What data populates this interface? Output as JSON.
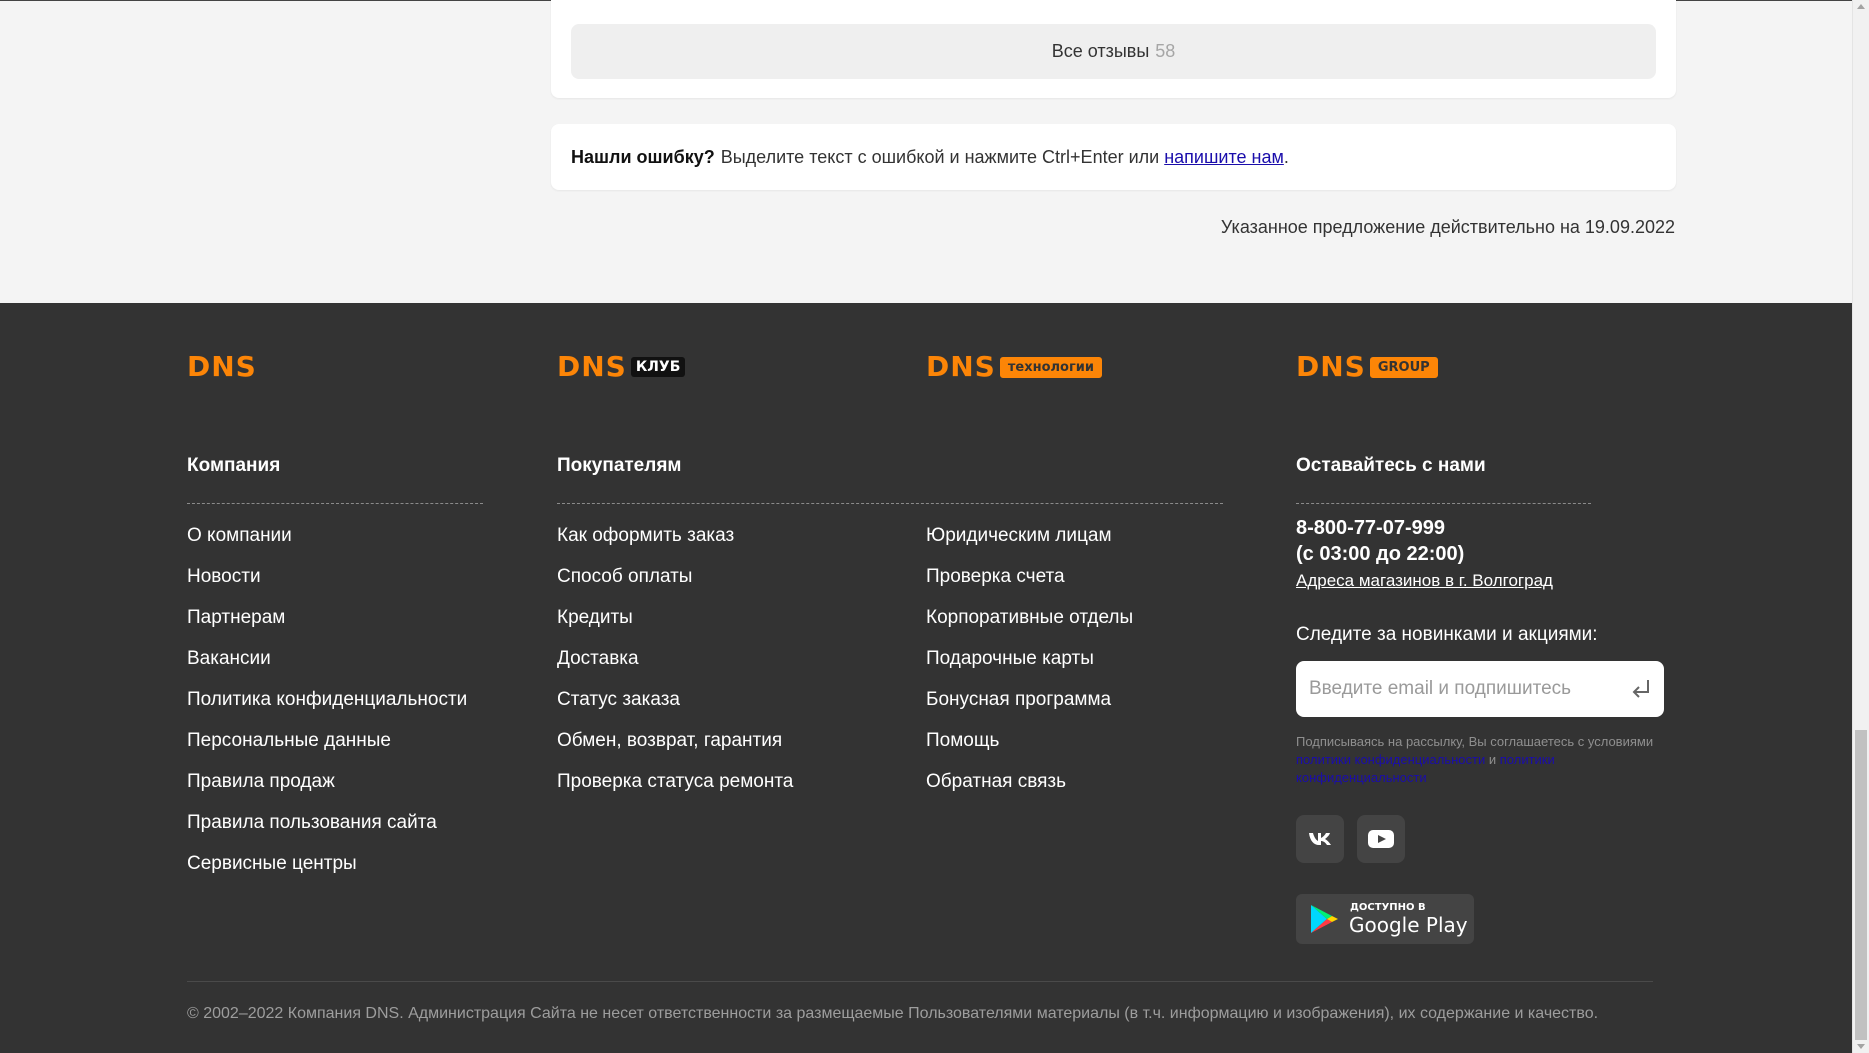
{
  "reviews": {
    "label": "Все отзывы",
    "count": "58"
  },
  "error_notice": {
    "bold": "Нашли ошибку?",
    "text": "Выделите текст с ошибкой и нажмите Ctrl+Enter или",
    "link": "напишите нам",
    "end": "."
  },
  "offer_note": "Указанное предложение действительно на 19.09.2022",
  "logos": {
    "dns": "DNS",
    "club_tag": "КЛУБ",
    "tech_tag": "технологии",
    "group_tag": "GROUP"
  },
  "columns": {
    "company": {
      "title": "Компания",
      "links": [
        "О компании",
        "Новости",
        "Партнерам",
        "Вакансии",
        "Политика конфиденциальности",
        "Персональные данные",
        "Правила продаж",
        "Правила пользования сайта",
        "Сервисные центры"
      ]
    },
    "buyers": {
      "title": "Покупателям",
      "links": [
        "Как оформить заказ",
        "Способ оплаты",
        "Кредиты",
        "Доставка",
        "Статус заказа",
        "Обмен, возврат, гарантия",
        "Проверка статуса ремонта"
      ]
    },
    "buyers2": {
      "links": [
        "Юридическим лицам",
        "Проверка счета",
        "Корпоративные отделы",
        "Подарочные карты",
        "Бонусная программа",
        "Помощь",
        "Обратная связь"
      ]
    },
    "contact": {
      "title": "Оставайтесь с нами",
      "phone": "8-800-77-07-999",
      "hours": "(с 03:00 до 22:00)",
      "stores_link": "Адреса магазинов в г. Волгоград",
      "follow": "Следите за новинками и акциями:",
      "email_placeholder": "Введите email и подпишитесь",
      "note_text": "Подписываясь на рассылку, Вы соглашаетесь с условиями",
      "note_link1": "политики конфиденциальности",
      "note_and": "и",
      "note_link2": "политики конфиденциальности"
    }
  },
  "gplay": {
    "small": "ДОСТУПНО В",
    "big": "Google Play"
  },
  "copyright": "© 2002–2022 Компания DNS. Администрация Сайта не несет ответственности за размещаемые Пользователями материалы (в т.ч. информацию и изображения), их содержание и качество.",
  "colors": {
    "accent": "#fc8507",
    "footer_bg": "#333333",
    "link": "#1a0dab"
  }
}
